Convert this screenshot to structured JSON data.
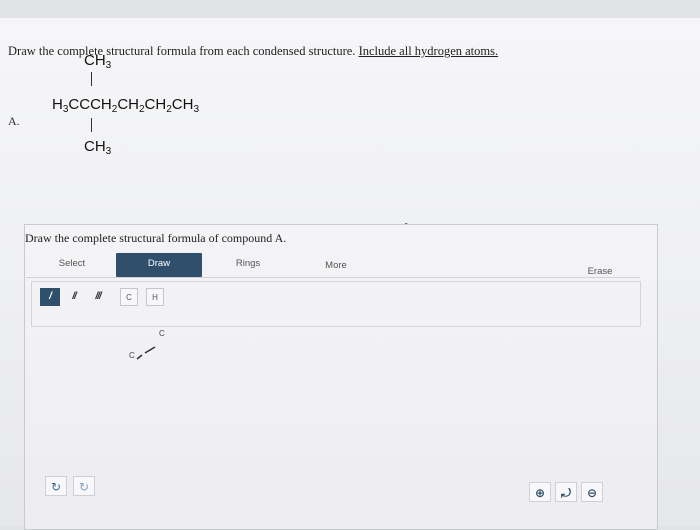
{
  "question": {
    "instruction_lead": "Draw the complete structural formula from each condensed structure.",
    "instruction_tail": "Include all hydrogen atoms.",
    "part_label": "A.",
    "formula": {
      "top_substituent": "CH",
      "top_sub": "3",
      "main_parts": [
        {
          "t": "H"
        },
        {
          "s": "3"
        },
        {
          "t": "CCCH"
        },
        {
          "s": "2"
        },
        {
          "t": "CH"
        },
        {
          "s": "2"
        },
        {
          "t": "CH"
        },
        {
          "s": "2"
        },
        {
          "t": "CH"
        },
        {
          "s": "3"
        }
      ],
      "bottom_substituent": "CH",
      "bottom_sub": "3"
    }
  },
  "editor": {
    "title": "Draw the complete structural formula of compound A.",
    "tabs": {
      "select": "Select",
      "draw": "Draw",
      "rings": "Rings",
      "more": "More",
      "erase": "Erase"
    },
    "active_tab": "Draw",
    "bond_tools": {
      "single": "/",
      "double": "//",
      "triple": "///"
    },
    "atom_tools": {
      "carbon": "C",
      "hydrogen": "H"
    },
    "canvas_atoms": {
      "atom1": "C",
      "atom2": "C"
    },
    "bottom_left_icons": [
      "undo-icon",
      "redo-icon"
    ],
    "zoom_icons": [
      "zoom-in-icon",
      "reset-icon",
      "zoom-out-icon"
    ],
    "colors": {
      "accent": "#2f4f6a",
      "panel_border": "#c9cacd"
    }
  }
}
